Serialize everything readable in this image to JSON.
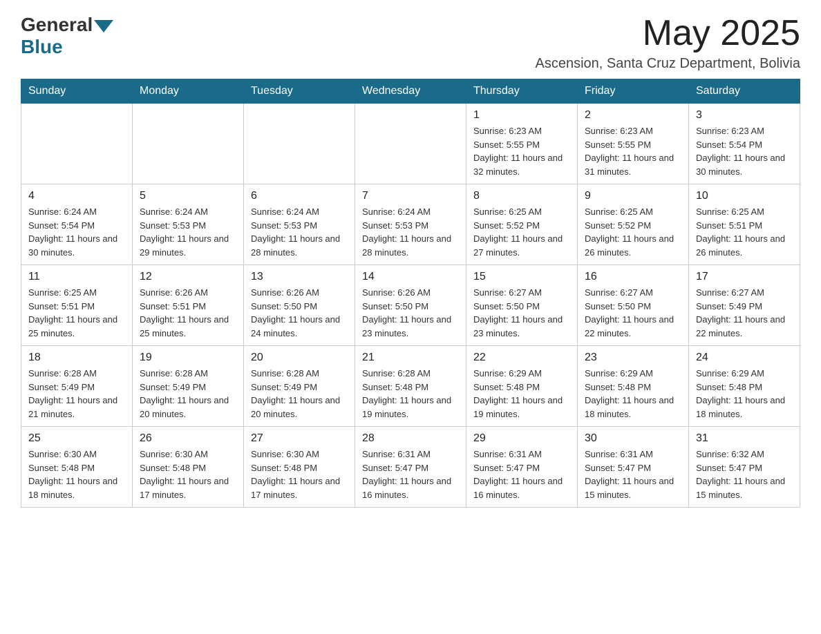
{
  "header": {
    "logo_general": "General",
    "logo_blue": "Blue",
    "month_title": "May 2025",
    "location": "Ascension, Santa Cruz Department, Bolivia"
  },
  "days_of_week": [
    "Sunday",
    "Monday",
    "Tuesday",
    "Wednesday",
    "Thursday",
    "Friday",
    "Saturday"
  ],
  "weeks": [
    [
      {
        "day": "",
        "sunrise": "",
        "sunset": "",
        "daylight": ""
      },
      {
        "day": "",
        "sunrise": "",
        "sunset": "",
        "daylight": ""
      },
      {
        "day": "",
        "sunrise": "",
        "sunset": "",
        "daylight": ""
      },
      {
        "day": "",
        "sunrise": "",
        "sunset": "",
        "daylight": ""
      },
      {
        "day": "1",
        "sunrise": "Sunrise: 6:23 AM",
        "sunset": "Sunset: 5:55 PM",
        "daylight": "Daylight: 11 hours and 32 minutes."
      },
      {
        "day": "2",
        "sunrise": "Sunrise: 6:23 AM",
        "sunset": "Sunset: 5:55 PM",
        "daylight": "Daylight: 11 hours and 31 minutes."
      },
      {
        "day": "3",
        "sunrise": "Sunrise: 6:23 AM",
        "sunset": "Sunset: 5:54 PM",
        "daylight": "Daylight: 11 hours and 30 minutes."
      }
    ],
    [
      {
        "day": "4",
        "sunrise": "Sunrise: 6:24 AM",
        "sunset": "Sunset: 5:54 PM",
        "daylight": "Daylight: 11 hours and 30 minutes."
      },
      {
        "day": "5",
        "sunrise": "Sunrise: 6:24 AM",
        "sunset": "Sunset: 5:53 PM",
        "daylight": "Daylight: 11 hours and 29 minutes."
      },
      {
        "day": "6",
        "sunrise": "Sunrise: 6:24 AM",
        "sunset": "Sunset: 5:53 PM",
        "daylight": "Daylight: 11 hours and 28 minutes."
      },
      {
        "day": "7",
        "sunrise": "Sunrise: 6:24 AM",
        "sunset": "Sunset: 5:53 PM",
        "daylight": "Daylight: 11 hours and 28 minutes."
      },
      {
        "day": "8",
        "sunrise": "Sunrise: 6:25 AM",
        "sunset": "Sunset: 5:52 PM",
        "daylight": "Daylight: 11 hours and 27 minutes."
      },
      {
        "day": "9",
        "sunrise": "Sunrise: 6:25 AM",
        "sunset": "Sunset: 5:52 PM",
        "daylight": "Daylight: 11 hours and 26 minutes."
      },
      {
        "day": "10",
        "sunrise": "Sunrise: 6:25 AM",
        "sunset": "Sunset: 5:51 PM",
        "daylight": "Daylight: 11 hours and 26 minutes."
      }
    ],
    [
      {
        "day": "11",
        "sunrise": "Sunrise: 6:25 AM",
        "sunset": "Sunset: 5:51 PM",
        "daylight": "Daylight: 11 hours and 25 minutes."
      },
      {
        "day": "12",
        "sunrise": "Sunrise: 6:26 AM",
        "sunset": "Sunset: 5:51 PM",
        "daylight": "Daylight: 11 hours and 25 minutes."
      },
      {
        "day": "13",
        "sunrise": "Sunrise: 6:26 AM",
        "sunset": "Sunset: 5:50 PM",
        "daylight": "Daylight: 11 hours and 24 minutes."
      },
      {
        "day": "14",
        "sunrise": "Sunrise: 6:26 AM",
        "sunset": "Sunset: 5:50 PM",
        "daylight": "Daylight: 11 hours and 23 minutes."
      },
      {
        "day": "15",
        "sunrise": "Sunrise: 6:27 AM",
        "sunset": "Sunset: 5:50 PM",
        "daylight": "Daylight: 11 hours and 23 minutes."
      },
      {
        "day": "16",
        "sunrise": "Sunrise: 6:27 AM",
        "sunset": "Sunset: 5:50 PM",
        "daylight": "Daylight: 11 hours and 22 minutes."
      },
      {
        "day": "17",
        "sunrise": "Sunrise: 6:27 AM",
        "sunset": "Sunset: 5:49 PM",
        "daylight": "Daylight: 11 hours and 22 minutes."
      }
    ],
    [
      {
        "day": "18",
        "sunrise": "Sunrise: 6:28 AM",
        "sunset": "Sunset: 5:49 PM",
        "daylight": "Daylight: 11 hours and 21 minutes."
      },
      {
        "day": "19",
        "sunrise": "Sunrise: 6:28 AM",
        "sunset": "Sunset: 5:49 PM",
        "daylight": "Daylight: 11 hours and 20 minutes."
      },
      {
        "day": "20",
        "sunrise": "Sunrise: 6:28 AM",
        "sunset": "Sunset: 5:49 PM",
        "daylight": "Daylight: 11 hours and 20 minutes."
      },
      {
        "day": "21",
        "sunrise": "Sunrise: 6:28 AM",
        "sunset": "Sunset: 5:48 PM",
        "daylight": "Daylight: 11 hours and 19 minutes."
      },
      {
        "day": "22",
        "sunrise": "Sunrise: 6:29 AM",
        "sunset": "Sunset: 5:48 PM",
        "daylight": "Daylight: 11 hours and 19 minutes."
      },
      {
        "day": "23",
        "sunrise": "Sunrise: 6:29 AM",
        "sunset": "Sunset: 5:48 PM",
        "daylight": "Daylight: 11 hours and 18 minutes."
      },
      {
        "day": "24",
        "sunrise": "Sunrise: 6:29 AM",
        "sunset": "Sunset: 5:48 PM",
        "daylight": "Daylight: 11 hours and 18 minutes."
      }
    ],
    [
      {
        "day": "25",
        "sunrise": "Sunrise: 6:30 AM",
        "sunset": "Sunset: 5:48 PM",
        "daylight": "Daylight: 11 hours and 18 minutes."
      },
      {
        "day": "26",
        "sunrise": "Sunrise: 6:30 AM",
        "sunset": "Sunset: 5:48 PM",
        "daylight": "Daylight: 11 hours and 17 minutes."
      },
      {
        "day": "27",
        "sunrise": "Sunrise: 6:30 AM",
        "sunset": "Sunset: 5:48 PM",
        "daylight": "Daylight: 11 hours and 17 minutes."
      },
      {
        "day": "28",
        "sunrise": "Sunrise: 6:31 AM",
        "sunset": "Sunset: 5:47 PM",
        "daylight": "Daylight: 11 hours and 16 minutes."
      },
      {
        "day": "29",
        "sunrise": "Sunrise: 6:31 AM",
        "sunset": "Sunset: 5:47 PM",
        "daylight": "Daylight: 11 hours and 16 minutes."
      },
      {
        "day": "30",
        "sunrise": "Sunrise: 6:31 AM",
        "sunset": "Sunset: 5:47 PM",
        "daylight": "Daylight: 11 hours and 15 minutes."
      },
      {
        "day": "31",
        "sunrise": "Sunrise: 6:32 AM",
        "sunset": "Sunset: 5:47 PM",
        "daylight": "Daylight: 11 hours and 15 minutes."
      }
    ]
  ]
}
